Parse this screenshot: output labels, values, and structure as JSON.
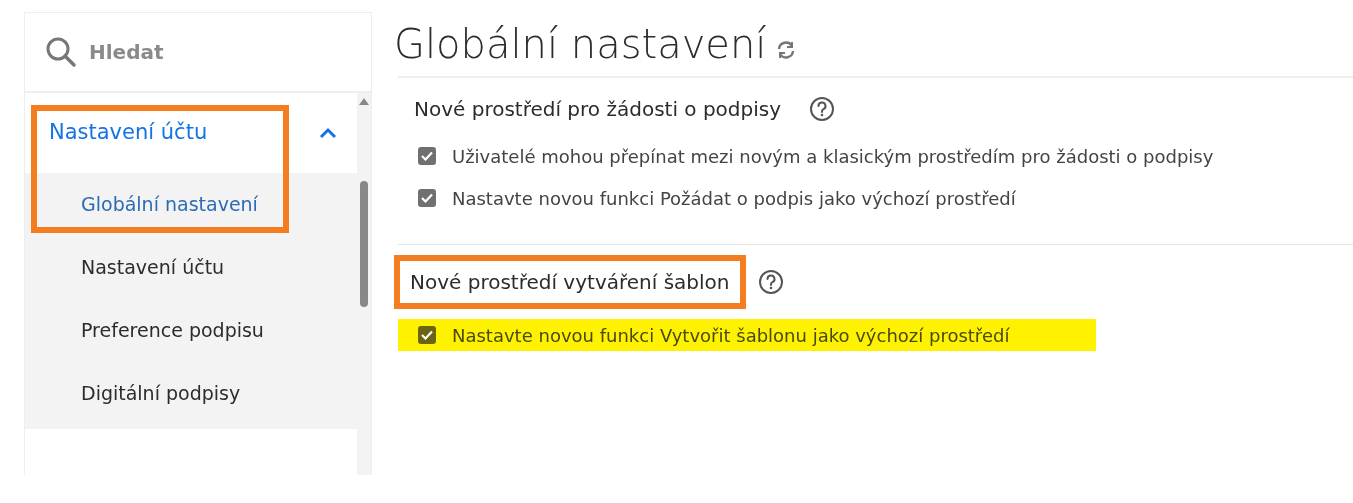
{
  "sidebar": {
    "search": {
      "placeholder": "Hledat"
    },
    "groups": [
      {
        "label": "Nastavení účtu",
        "expanded": true,
        "highlighted": true,
        "children": [
          {
            "label": "Globální nastavení",
            "selected": true
          },
          {
            "label": "Nastavení účtu",
            "selected": false
          },
          {
            "label": "Preference podpisu",
            "selected": false
          },
          {
            "label": "Digitální podpisy",
            "selected": false
          }
        ]
      }
    ]
  },
  "page": {
    "title": "Globální nastavení",
    "sections": [
      {
        "heading": "Nové prostředí pro žádosti o podpisy",
        "highlighted": false,
        "options": [
          {
            "label": "Uživatelé mohou přepínat mezi novým a klasickým prostředím pro žádosti o podpisy",
            "checked": true,
            "highlighted": false
          },
          {
            "label": "Nastavte novou funkci Požádat o podpis jako výchozí prostředí",
            "checked": true,
            "highlighted": false
          }
        ]
      },
      {
        "heading": "Nové prostředí vytváření šablon",
        "highlighted": true,
        "options": [
          {
            "label": "Nastavte novou funkci Vytvořit šablonu jako výchozí prostředí",
            "checked": true,
            "highlighted": true
          }
        ]
      }
    ]
  }
}
